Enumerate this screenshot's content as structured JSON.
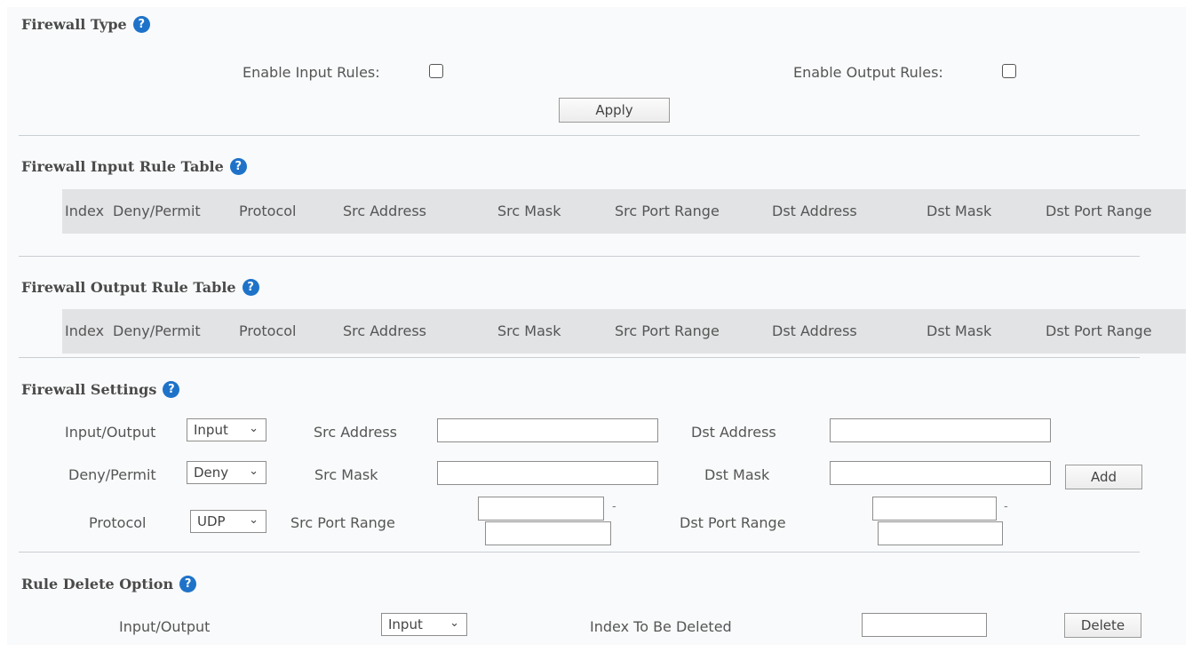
{
  "firewall_type": {
    "title": "Firewall Type",
    "enable_input_label": "Enable Input Rules:",
    "enable_output_label": "Enable Output Rules:",
    "enable_input_checked": false,
    "enable_output_checked": false,
    "apply_label": "Apply"
  },
  "input_rule_table": {
    "title": "Firewall Input Rule Table",
    "columns": [
      "Index",
      "Deny/Permit",
      "Protocol",
      "Src Address",
      "Src Mask",
      "Src Port Range",
      "Dst Address",
      "Dst Mask",
      "Dst Port Range"
    ],
    "rows": []
  },
  "output_rule_table": {
    "title": "Firewall Output Rule Table",
    "columns": [
      "Index",
      "Deny/Permit",
      "Protocol",
      "Src Address",
      "Src Mask",
      "Src Port Range",
      "Dst Address",
      "Dst Mask",
      "Dst Port Range"
    ],
    "rows": []
  },
  "settings": {
    "title": "Firewall Settings",
    "io_label": "Input/Output",
    "io_value": "Input",
    "deny_permit_label": "Deny/Permit",
    "deny_permit_value": "Deny",
    "protocol_label": "Protocol",
    "protocol_value": "UDP",
    "src_address_label": "Src Address",
    "src_mask_label": "Src Mask",
    "src_port_label": "Src Port Range",
    "dst_address_label": "Dst Address",
    "dst_mask_label": "Dst Mask",
    "dst_port_label": "Dst Port Range",
    "src_address_value": "",
    "src_mask_value": "",
    "src_port_start": "",
    "src_port_end": "",
    "dst_address_value": "",
    "dst_mask_value": "",
    "dst_port_start": "",
    "dst_port_end": "",
    "range_separator": "-",
    "add_label": "Add"
  },
  "delete_option": {
    "title": "Rule Delete Option",
    "io_label": "Input/Output",
    "io_value": "Input",
    "index_label": "Index To Be Deleted",
    "index_value": "",
    "delete_label": "Delete"
  },
  "icons": {
    "help": "help-icon",
    "chevron": "chevron-down-icon"
  },
  "colors": {
    "help_icon": "#1e73c9",
    "table_header_bg": "#e2e3e5",
    "page_bg": "#f9fafb"
  }
}
